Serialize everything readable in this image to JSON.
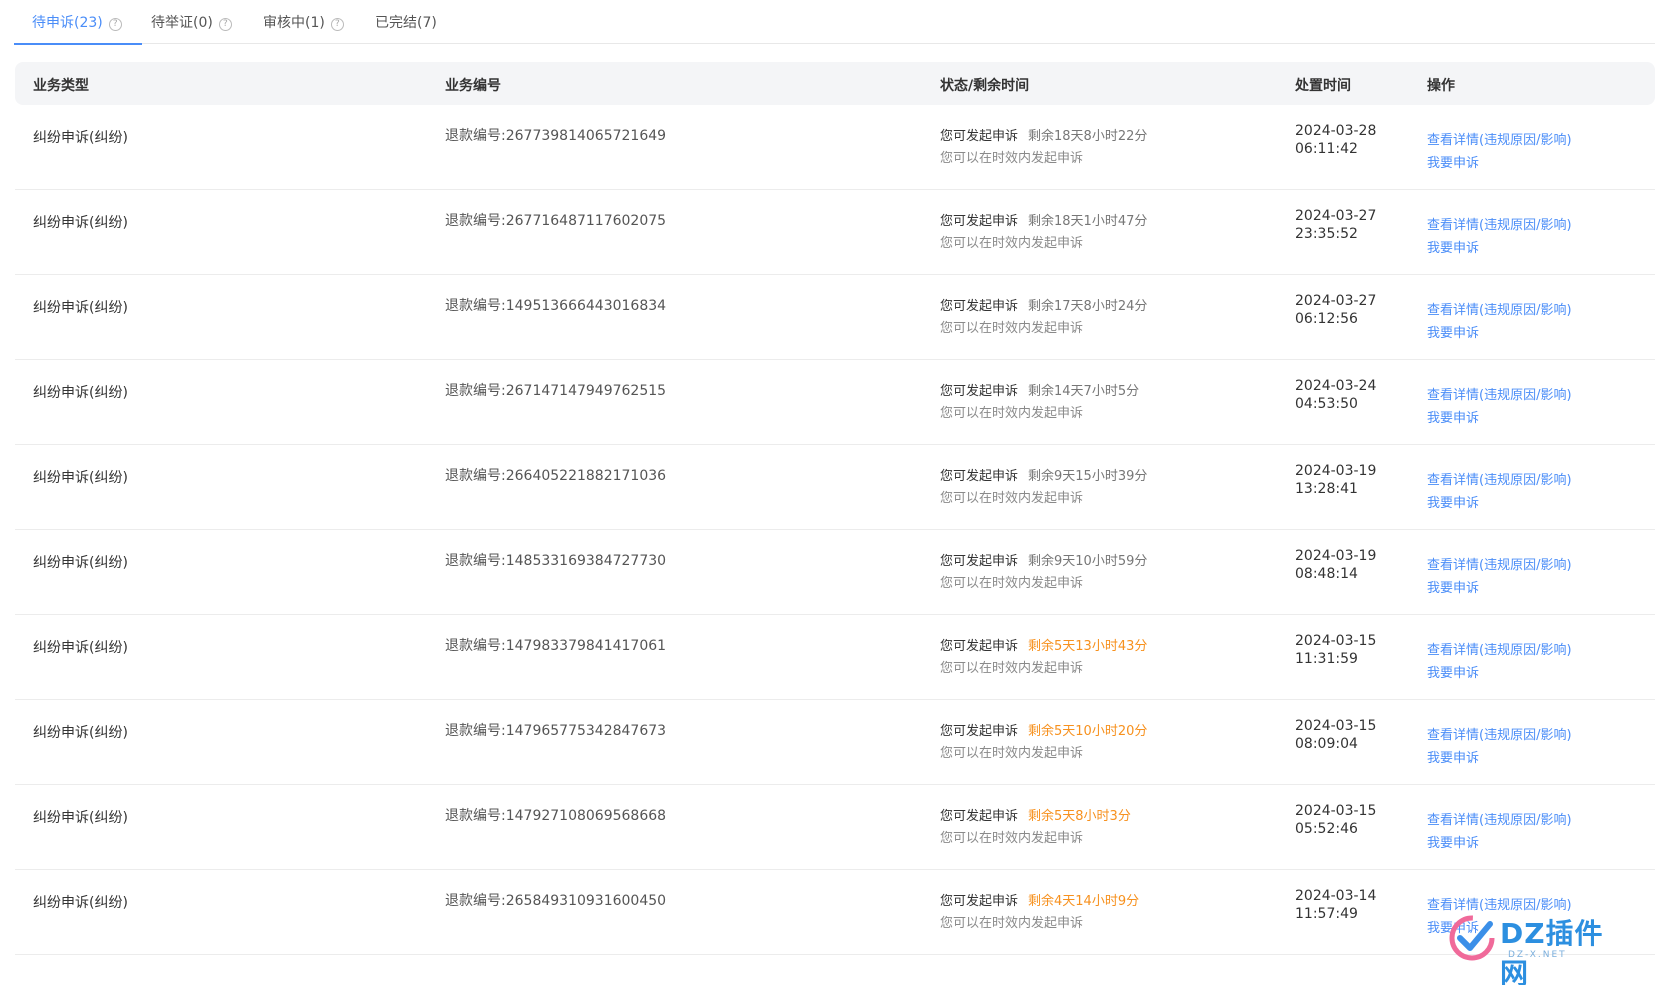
{
  "tabs": [
    {
      "label": "待申诉(23)",
      "active": true,
      "help": "?"
    },
    {
      "label": "待举证(0)",
      "active": false,
      "help": "?"
    },
    {
      "label": "审核中(1)",
      "active": false,
      "help": "?"
    },
    {
      "label": "已完结(7)",
      "active": false
    }
  ],
  "table": {
    "headers": {
      "type": "业务类型",
      "no": "业务编号",
      "status": "状态/剩余时间",
      "time": "处置时间",
      "ops": "操作"
    },
    "rows": [
      {
        "type": "纠纷申诉(纠纷)",
        "no": "退款编号:267739814065721649",
        "status": "您可发起申诉",
        "remaining": "剩余18天8小时22分",
        "warn": false,
        "hint": "您可以在时效内发起申诉",
        "date": "2024-03-28",
        "clock": "06:11:42",
        "detail": "查看详情(违规原因/影响)",
        "appeal": "我要申诉"
      },
      {
        "type": "纠纷申诉(纠纷)",
        "no": "退款编号:267716487117602075",
        "status": "您可发起申诉",
        "remaining": "剩余18天1小时47分",
        "warn": false,
        "hint": "您可以在时效内发起申诉",
        "date": "2024-03-27",
        "clock": "23:35:52",
        "detail": "查看详情(违规原因/影响)",
        "appeal": "我要申诉"
      },
      {
        "type": "纠纷申诉(纠纷)",
        "no": "退款编号:149513666443016834",
        "status": "您可发起申诉",
        "remaining": "剩余17天8小时24分",
        "warn": false,
        "hint": "您可以在时效内发起申诉",
        "date": "2024-03-27",
        "clock": "06:12:56",
        "detail": "查看详情(违规原因/影响)",
        "appeal": "我要申诉"
      },
      {
        "type": "纠纷申诉(纠纷)",
        "no": "退款编号:267147147949762515",
        "status": "您可发起申诉",
        "remaining": "剩余14天7小时5分",
        "warn": false,
        "hint": "您可以在时效内发起申诉",
        "date": "2024-03-24",
        "clock": "04:53:50",
        "detail": "查看详情(违规原因/影响)",
        "appeal": "我要申诉"
      },
      {
        "type": "纠纷申诉(纠纷)",
        "no": "退款编号:266405221882171036",
        "status": "您可发起申诉",
        "remaining": "剩余9天15小时39分",
        "warn": false,
        "hint": "您可以在时效内发起申诉",
        "date": "2024-03-19",
        "clock": "13:28:41",
        "detail": "查看详情(违规原因/影响)",
        "appeal": "我要申诉"
      },
      {
        "type": "纠纷申诉(纠纷)",
        "no": "退款编号:148533169384727730",
        "status": "您可发起申诉",
        "remaining": "剩余9天10小时59分",
        "warn": false,
        "hint": "您可以在时效内发起申诉",
        "date": "2024-03-19",
        "clock": "08:48:14",
        "detail": "查看详情(违规原因/影响)",
        "appeal": "我要申诉"
      },
      {
        "type": "纠纷申诉(纠纷)",
        "no": "退款编号:147983379841417061",
        "status": "您可发起申诉",
        "remaining": "剩余5天13小时43分",
        "warn": true,
        "hint": "您可以在时效内发起申诉",
        "date": "2024-03-15",
        "clock": "11:31:59",
        "detail": "查看详情(违规原因/影响)",
        "appeal": "我要申诉"
      },
      {
        "type": "纠纷申诉(纠纷)",
        "no": "退款编号:147965775342847673",
        "status": "您可发起申诉",
        "remaining": "剩余5天10小时20分",
        "warn": true,
        "hint": "您可以在时效内发起申诉",
        "date": "2024-03-15",
        "clock": "08:09:04",
        "detail": "查看详情(违规原因/影响)",
        "appeal": "我要申诉"
      },
      {
        "type": "纠纷申诉(纠纷)",
        "no": "退款编号:147927108069568668",
        "status": "您可发起申诉",
        "remaining": "剩余5天8小时3分",
        "warn": true,
        "hint": "您可以在时效内发起申诉",
        "date": "2024-03-15",
        "clock": "05:52:46",
        "detail": "查看详情(违规原因/影响)",
        "appeal": "我要申诉"
      },
      {
        "type": "纠纷申诉(纠纷)",
        "no": "退款编号:265849310931600450",
        "status": "您可发起申诉",
        "remaining": "剩余4天14小时9分",
        "warn": true,
        "hint": "您可以在时效内发起申诉",
        "date": "2024-03-14",
        "clock": "11:57:49",
        "detail": "查看详情(违规原因/影响)",
        "appeal": "我要申诉"
      }
    ]
  },
  "colors": {
    "accent": "#4a8df8",
    "warning": "#f7911e"
  },
  "watermark": {
    "text": "DZ插件网",
    "sub": "DZ-X.NET",
    "icon": "dz-logo-icon"
  }
}
